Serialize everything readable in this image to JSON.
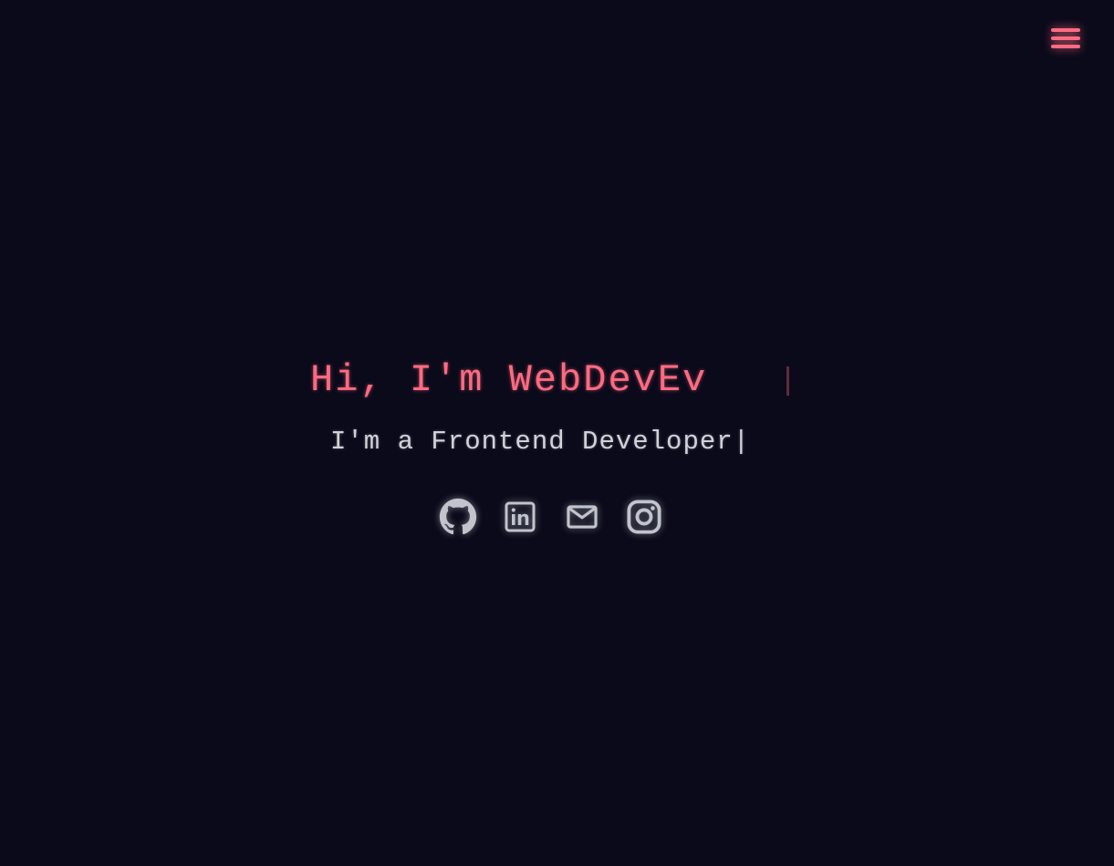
{
  "nav": {
    "menu_icon": "hamburger-menu-icon"
  },
  "hero": {
    "title": "Hi, I'm WebDevEv",
    "subtitle": "I'm a Frontend Developer|"
  },
  "socials": [
    {
      "name": "GitHub",
      "icon": "github-icon"
    },
    {
      "name": "LinkedIn",
      "icon": "linkedin-icon"
    },
    {
      "name": "Email",
      "icon": "mail-icon"
    },
    {
      "name": "Instagram",
      "icon": "instagram-icon"
    }
  ],
  "colors": {
    "background": "#0a0a1a",
    "accent": "#ff6b81",
    "text": "#cfd2d8",
    "icon": "#c2c4cc"
  }
}
